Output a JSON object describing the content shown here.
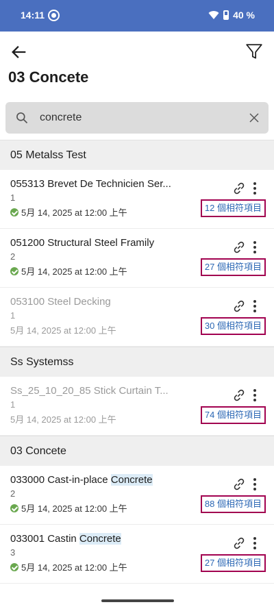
{
  "status_bar": {
    "time": "14:11",
    "battery": "40 %"
  },
  "page": {
    "title": "03  Concete"
  },
  "search": {
    "value": "concrete",
    "placeholder": ""
  },
  "sections": [
    {
      "header": "05 Metalss Test",
      "rows": [
        {
          "title": "055313 Brevet De Technicien Ser...",
          "title_pre": "055313 Brevet De Technicien Ser...",
          "title_hl": "",
          "version": "1",
          "date": "5月 14, 2025 at 12:00 上午",
          "checked": true,
          "matches": "12 個相符項目",
          "disabled": false
        },
        {
          "title": "051200 Structural Steel Framily",
          "title_pre": "051200 Structural Steel Framily",
          "title_hl": "",
          "version": "2",
          "date": "5月 14, 2025 at 12:00 上午",
          "checked": true,
          "matches": "27 個相符項目",
          "disabled": false
        },
        {
          "title": "053100 Steel Decking",
          "title_pre": "053100 Steel Decking",
          "title_hl": "",
          "version": "1",
          "date": "5月 14, 2025 at 12:00 上午",
          "checked": false,
          "matches": "30 個相符項目",
          "disabled": true
        }
      ]
    },
    {
      "header": "Ss Systemss",
      "rows": [
        {
          "title": "Ss_25_10_20_85 Stick Curtain T...",
          "title_pre": "Ss_25_10_20_85 Stick Curtain T...",
          "title_hl": "",
          "version": "1",
          "date": "5月 14, 2025 at 12:00 上午",
          "checked": false,
          "matches": "74 個相符項目",
          "disabled": true
        }
      ]
    },
    {
      "header": "03 Concete",
      "rows": [
        {
          "title": "033000 Cast-in-place Concrete",
          "title_pre": "033000 Cast-in-place ",
          "title_hl": "Concrete",
          "version": "2",
          "date": "5月 14, 2025 at 12:00 上午",
          "checked": true,
          "matches": "88 個相符項目",
          "disabled": false
        },
        {
          "title": "033001 Castin Concrete",
          "title_pre": "033001 Castin ",
          "title_hl": "Concrete",
          "version": "3",
          "date": "5月 14, 2025 at 12:00 上午",
          "checked": true,
          "matches": "27 個相符項目",
          "disabled": false
        }
      ]
    }
  ],
  "colors": {
    "status_bar": "#4a6fbf",
    "match_border": "#a1004f",
    "match_text": "#2b67b4",
    "check": "#6aa84f"
  },
  "icons": [
    "back-arrow-icon",
    "filter-icon",
    "search-icon",
    "clear-icon",
    "link-icon",
    "more-vert-icon",
    "check-circle-icon"
  ]
}
